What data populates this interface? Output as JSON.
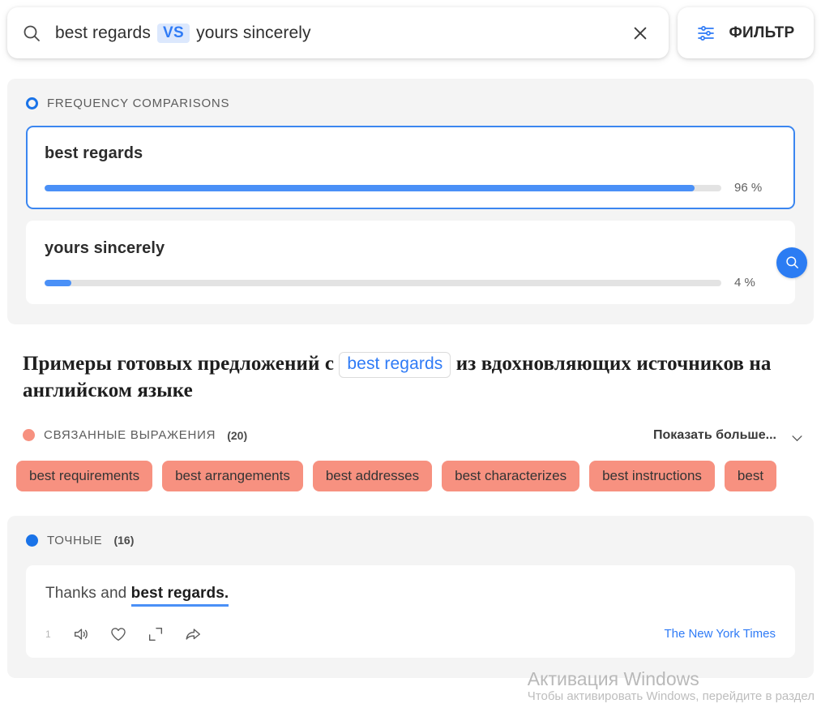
{
  "search": {
    "term_a": "best regards",
    "vs_label": "VS",
    "term_b": "yours sincerely",
    "placeholder": "best regards VS yours sincerely",
    "search_icon": "search-icon",
    "clear_icon": "close-icon"
  },
  "filter": {
    "label": "ФИЛЬТР",
    "icon": "sliders-icon",
    "accent": "#2f7bf6"
  },
  "frequency": {
    "section_label": "FREQUENCY COMPARISONS",
    "marker_icon": "ring-icon",
    "accent": "#1a73e8",
    "items": [
      {
        "term": "best regards",
        "percent_label": "96 %",
        "percent": 96,
        "selected": true,
        "bar_color": "#4a90f7"
      },
      {
        "term": "yours sincerely",
        "percent_label": "4 %",
        "percent": 4,
        "selected": false,
        "bar_color": "#4a90f7"
      }
    ],
    "mini_search_icon": "search-circle-icon"
  },
  "heading": {
    "before": "Примеры готовых предложений с",
    "term": "best regards",
    "after": "из вдохновляющих источников на английском языке"
  },
  "related": {
    "section_label": "СВЯЗАННЫЕ ВЫРАЖЕНИЯ",
    "count": "(20)",
    "marker_icon": "dot-icon",
    "accent": "#f79180",
    "show_more_label": "Показать больше...",
    "chevron_icon": "chevron-down-icon",
    "chips": [
      "best requirements",
      "best arrangements",
      "best addresses",
      "best characterizes",
      "best instructions",
      "best"
    ]
  },
  "exact": {
    "section_label": "ТОЧНЫЕ",
    "count": "(16)",
    "marker_icon": "dot-icon",
    "accent": "#1a73e8",
    "results": [
      {
        "index": "1",
        "prefix": "Thanks and ",
        "match": "best regards.",
        "source": "The New York Times",
        "actions": [
          {
            "name": "speaker-icon",
            "label": "Listen"
          },
          {
            "name": "heart-icon",
            "label": "Favorite"
          },
          {
            "name": "expand-icon",
            "label": "Expand"
          },
          {
            "name": "share-icon",
            "label": "Share"
          }
        ]
      }
    ]
  },
  "watermark": {
    "title": "Активация Windows",
    "subtitle": "Чтобы активировать Windows, перейдите в раздел"
  }
}
